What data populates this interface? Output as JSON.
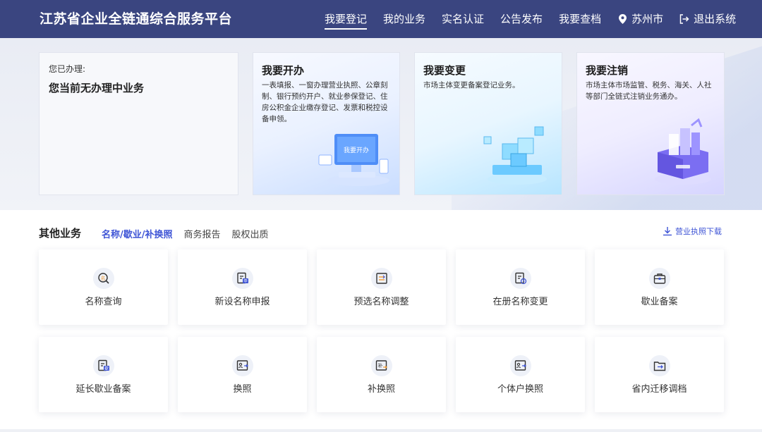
{
  "header": {
    "title": "江苏省企业全链通综合服务平台",
    "nav": [
      {
        "label": "我要登记",
        "active": true
      },
      {
        "label": "我的业务"
      },
      {
        "label": "实名认证"
      },
      {
        "label": "公告发布"
      },
      {
        "label": "我要查档"
      }
    ],
    "city": "苏州市",
    "logout": "退出系统"
  },
  "hero": {
    "status_label": "您已办理:",
    "status_text": "您当前无办理中业务",
    "cards": [
      {
        "title": "我要开办",
        "desc": "一表填报、一窗办理营业执照、公章刻制、银行预约开户、就业参保登记、住房公积金企业缴存登记、发票和税控设备申领。",
        "illus_text": "我要开办"
      },
      {
        "title": "我要变更",
        "desc": "市场主体变更备案登记业务。"
      },
      {
        "title": "我要注销",
        "desc": "市场主体市场监管、税务、海关、人社等部门全链式注销业务通办。"
      }
    ]
  },
  "other": {
    "title": "其他业务",
    "tabs": [
      {
        "label": "名称/歇业/补换照",
        "active": true
      },
      {
        "label": "商务报告"
      },
      {
        "label": "股权出质"
      }
    ],
    "download": "营业执照下载",
    "tiles": [
      {
        "label": "名称查询",
        "icon": "search-name-icon",
        "glyph": "名"
      },
      {
        "label": "新设名称申报",
        "icon": "doc-apply-icon",
        "glyph": "申"
      },
      {
        "label": "预选名称调整",
        "icon": "adjust-icon",
        "glyph": ""
      },
      {
        "label": "在册名称变更",
        "icon": "doc-change-icon",
        "glyph": ""
      },
      {
        "label": "歇业备案",
        "icon": "briefcase-icon",
        "glyph": ""
      },
      {
        "label": "延长歇业备案",
        "icon": "doc-extend-icon",
        "glyph": "歇"
      },
      {
        "label": "换照",
        "icon": "license-swap-icon",
        "glyph": ""
      },
      {
        "label": "补换照",
        "icon": "license-reissue-icon",
        "glyph": "补"
      },
      {
        "label": "个体户换照",
        "icon": "individual-license-icon",
        "glyph": ""
      },
      {
        "label": "省内迁移调档",
        "icon": "folder-transfer-icon",
        "glyph": ""
      }
    ]
  },
  "colors": {
    "header_bg": "#3a4580",
    "accent": "#3f55d6",
    "icon_orange": "#f0a040"
  }
}
